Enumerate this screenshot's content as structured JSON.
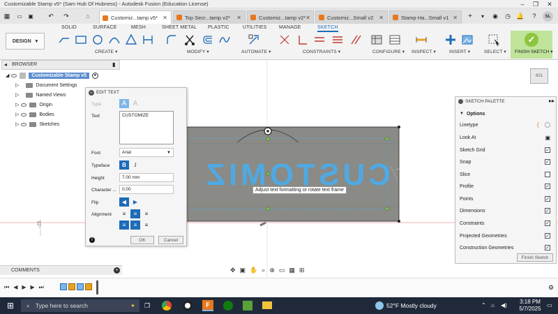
{
  "window": {
    "title": "Customizable Stamp v5* (Sam Hub Of Hubness) - Autodesk Fusion (Education License)"
  },
  "tabs": [
    {
      "label": "Customiz...tamp v5*"
    },
    {
      "label": "Top Secr...tamp v2*"
    },
    {
      "label": "Customiz...tamp v2*"
    },
    {
      "label": "Customiz...Small v2"
    },
    {
      "label": "Stamp Ha...Small v1"
    }
  ],
  "user": {
    "initials": "SL"
  },
  "ribbon": {
    "workspace": "DESIGN",
    "tabs": [
      "SOLID",
      "SURFACE",
      "MESH",
      "SHEET METAL",
      "PLASTIC",
      "UTILITIES",
      "MANAGE",
      "SKETCH"
    ],
    "groups": {
      "create": "CREATE ▾",
      "modify": "MODIFY ▾",
      "automate": "AUTOMATE ▾",
      "constraints": "CONSTRAINTS ▾",
      "configure": "CONFIGURE ▾",
      "inspect": "INSPECT ▾",
      "insert": "INSERT ▾",
      "select": "SELECT ▾",
      "finish": "FINISH SKETCH ▾"
    }
  },
  "browser": {
    "title": "BROWSER",
    "root": "Customizable Stamp v5",
    "items": [
      {
        "label": "Document Settings"
      },
      {
        "label": "Named Views"
      },
      {
        "label": "Origin"
      },
      {
        "label": "Bodies"
      },
      {
        "label": "Sketches"
      }
    ]
  },
  "edit_text": {
    "title": "EDIT TEXT",
    "type_label": "Type",
    "text_label": "Text",
    "text_value": "CUSTOMIZE",
    "font_label": "Font",
    "font_value": "Arial",
    "typeface_label": "Typeface",
    "height_label": "Height",
    "height_value": "7.00 mm",
    "char_label": "Character ...",
    "char_value": "0.00",
    "flip_label": "Flip",
    "align_label": "Alignment",
    "ok": "OK",
    "cancel": "Cancel"
  },
  "canvas": {
    "stamp_text": "CUSTOMIZ",
    "tooltip": "Adjust text formatting or rotate text frame",
    "axis_label": "-25",
    "viewcube_label": "601"
  },
  "palette": {
    "title": "SKETCH PALETTE",
    "section": "Options",
    "rows": [
      {
        "label": "Linetype",
        "checked": null
      },
      {
        "label": "Look At",
        "checked": null
      },
      {
        "label": "Sketch Grid",
        "checked": true
      },
      {
        "label": "Snap",
        "checked": true
      },
      {
        "label": "Slice",
        "checked": false
      },
      {
        "label": "Profile",
        "checked": true
      },
      {
        "label": "Points",
        "checked": true
      },
      {
        "label": "Dimensions",
        "checked": true
      },
      {
        "label": "Constraints",
        "checked": true
      },
      {
        "label": "Projected Geometries",
        "checked": true
      },
      {
        "label": "Construction Geometries",
        "checked": true
      }
    ],
    "finish": "Finish Sketch"
  },
  "comments": {
    "title": "COMMENTS"
  },
  "taskbar": {
    "search": "Type here to search",
    "weather": "52°F  Mostly cloudy",
    "time": "3:18 PM",
    "date": "5/7/2025"
  },
  "colors": {
    "accent": "#1e6bb8",
    "sketch_blue": "#4fa9e3",
    "stamp": "#8a8a86",
    "finish_green": "#8cc63f",
    "taskbar": "#20293a"
  }
}
